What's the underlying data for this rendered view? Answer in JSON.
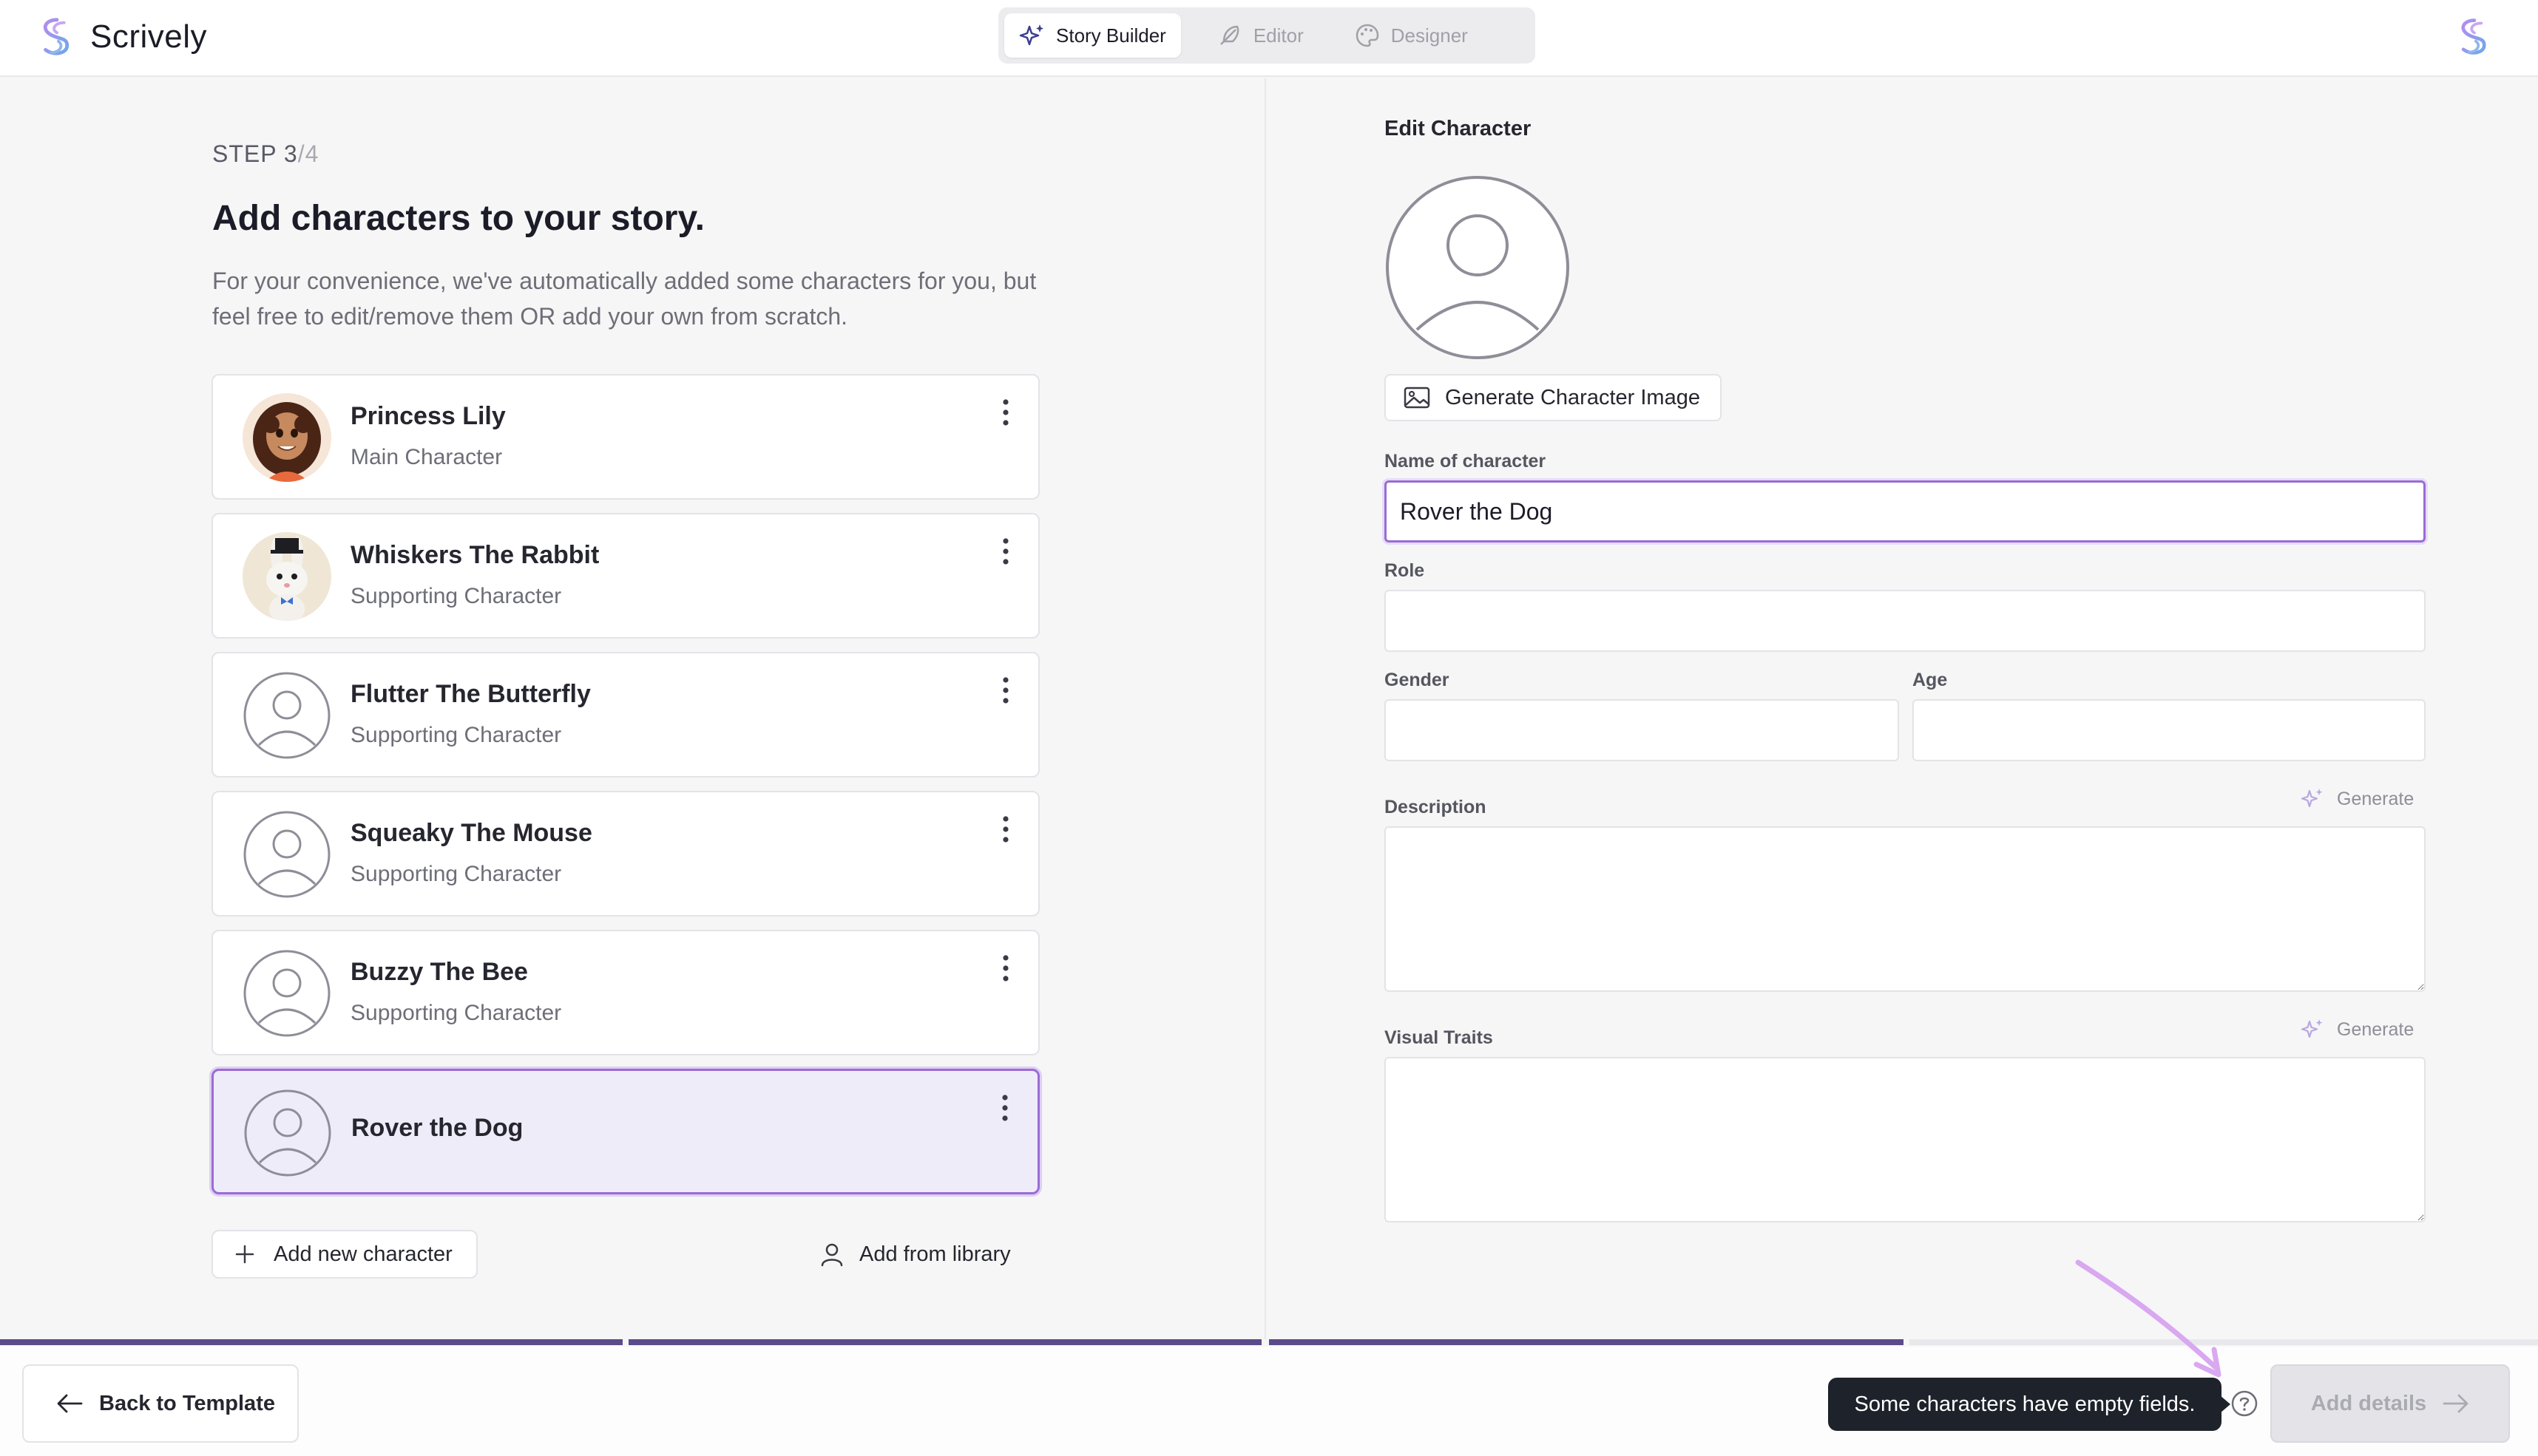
{
  "app": {
    "name": "Scrively"
  },
  "modes": [
    {
      "label": "Story Builder",
      "active": true
    },
    {
      "label": "Editor",
      "active": false
    },
    {
      "label": "Designer",
      "active": false
    }
  ],
  "step": {
    "prefix": "STEP ",
    "current": "3",
    "separator": "/",
    "total": "4"
  },
  "page": {
    "title": "Add characters to your story.",
    "description": "For your convenience, we've automatically added some characters for you, but feel free to edit/remove them OR add your own from scratch."
  },
  "characters": [
    {
      "name": "Princess Lily",
      "role": "Main Character",
      "avatar": "princess-portrait"
    },
    {
      "name": "Whiskers The Rabbit",
      "role": "Supporting Character",
      "avatar": "rabbit-portrait"
    },
    {
      "name": "Flutter The Butterfly",
      "role": "Supporting Character",
      "avatar": "user-placeholder"
    },
    {
      "name": "Squeaky The Mouse",
      "role": "Supporting Character",
      "avatar": "user-placeholder"
    },
    {
      "name": "Buzzy The Bee",
      "role": "Supporting Character",
      "avatar": "user-placeholder"
    },
    {
      "name": "Rover the Dog",
      "role": "",
      "avatar": "user-placeholder",
      "selected": true
    }
  ],
  "actions": {
    "add_new": "Add new character",
    "add_library": "Add from library"
  },
  "editor": {
    "title": "Edit Character",
    "generate_image": "Generate Character Image",
    "name_label": "Name of character",
    "name_value": "Rover the Dog",
    "role_label": "Role",
    "role_value": "",
    "gender_label": "Gender",
    "gender_value": "",
    "age_label": "Age",
    "age_value": "",
    "description_label": "Description",
    "description_value": "",
    "visual_label": "Visual Traits",
    "visual_value": "",
    "generate_label": "Generate"
  },
  "progress_segments": [
    1,
    1,
    1,
    0
  ],
  "footer": {
    "back_label": "Back to Template",
    "tooltip": "Some characters have empty fields.",
    "next_label": "Add details"
  },
  "colors": {
    "accent": "#9b6bd6",
    "progress": "#5b4b8a",
    "tooltip_bg": "#1e222b"
  }
}
